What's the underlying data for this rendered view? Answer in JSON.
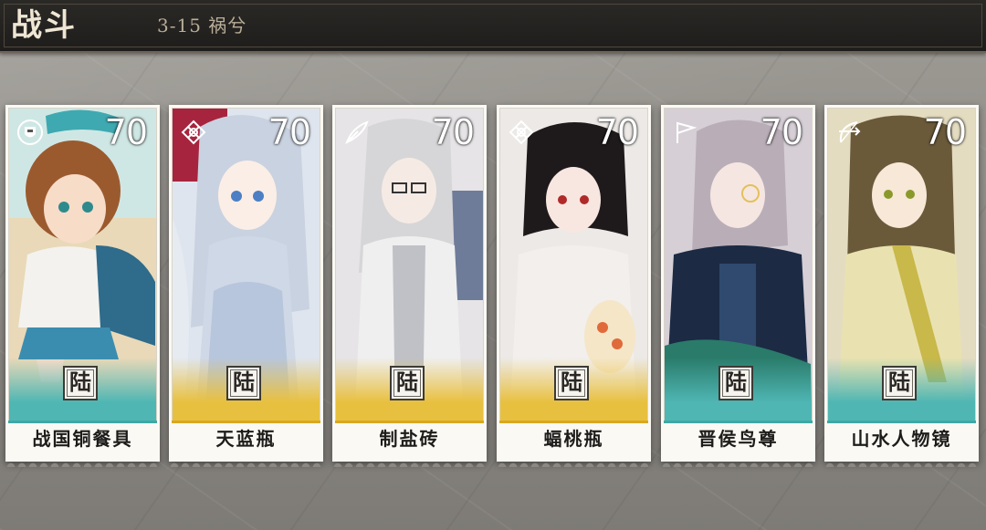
{
  "header": {
    "title": "战斗",
    "stage": "3-15 祸兮"
  },
  "cards": [
    {
      "name": "战国铜餐具",
      "level": "70",
      "badge": "陆",
      "class_icon": "shield-icon",
      "band_color": "#4fb6b3",
      "accent": "#3fa8a5"
    },
    {
      "name": "天蓝瓶",
      "level": "70",
      "badge": "陆",
      "class_icon": "knot-icon",
      "band_color": "#e8c040",
      "accent": "#d9a820"
    },
    {
      "name": "制盐砖",
      "level": "70",
      "badge": "陆",
      "class_icon": "quill-icon",
      "band_color": "#e8c040",
      "accent": "#d9a820"
    },
    {
      "name": "蝠桃瓶",
      "level": "70",
      "badge": "陆",
      "class_icon": "knot-icon",
      "band_color": "#e8c040",
      "accent": "#d9a820"
    },
    {
      "name": "晋侯鸟尊",
      "level": "70",
      "badge": "陆",
      "class_icon": "flag-icon",
      "band_color": "#4fb6b3",
      "accent": "#3fa8a5"
    },
    {
      "name": "山水人物镜",
      "level": "70",
      "badge": "陆",
      "class_icon": "bow-icon",
      "band_color": "#4fb6b3",
      "accent": "#3fa8a5"
    }
  ]
}
